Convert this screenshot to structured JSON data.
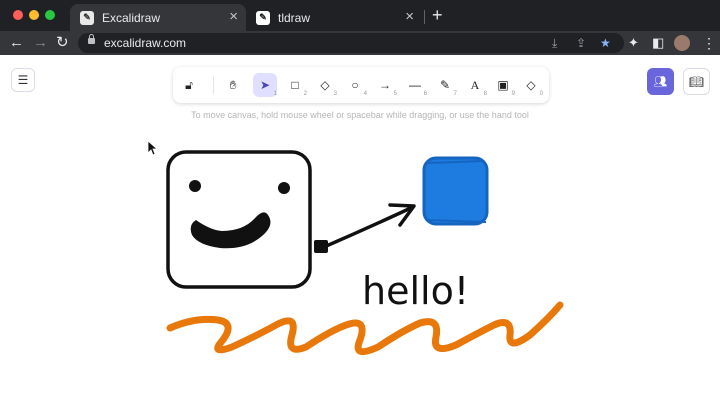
{
  "browser": {
    "tabs": [
      {
        "title": "Excalidraw",
        "favicon": "excalidraw-favicon",
        "active": true
      },
      {
        "title": "tldraw",
        "favicon": "tldraw-favicon",
        "active": false
      }
    ],
    "url": "excalidraw.com",
    "window_controls": [
      "close",
      "minimize",
      "maximize"
    ]
  },
  "app": {
    "tools": [
      {
        "name": "lock",
        "icon": "lock-icon",
        "key": ""
      },
      {
        "name": "hand",
        "icon": "hand-icon",
        "key": ""
      },
      {
        "name": "selection",
        "icon": "pointer-icon",
        "key": "1",
        "selected": true
      },
      {
        "name": "rectangle",
        "icon": "rectangle-icon",
        "key": "2"
      },
      {
        "name": "diamond",
        "icon": "diamond-icon",
        "key": "3"
      },
      {
        "name": "ellipse",
        "icon": "ellipse-icon",
        "key": "4"
      },
      {
        "name": "arrow",
        "icon": "arrow-icon",
        "key": "5"
      },
      {
        "name": "line",
        "icon": "line-icon",
        "key": "6"
      },
      {
        "name": "draw",
        "icon": "pencil-icon",
        "key": "7"
      },
      {
        "name": "text",
        "icon": "text-icon",
        "key": "8"
      },
      {
        "name": "image",
        "icon": "image-icon",
        "key": "9"
      },
      {
        "name": "eraser",
        "icon": "eraser-icon",
        "key": "0"
      }
    ],
    "hint": "To move canvas, hold mouse wheel or spacebar while dragging, or use the hand tool",
    "canvas": {
      "text": "hello!",
      "colors": {
        "square_fill": "#1e7be0",
        "square_stroke": "#1565c0",
        "squiggle": "#e8780a",
        "ink": "#111111"
      }
    },
    "accent_color": "#6965db"
  }
}
